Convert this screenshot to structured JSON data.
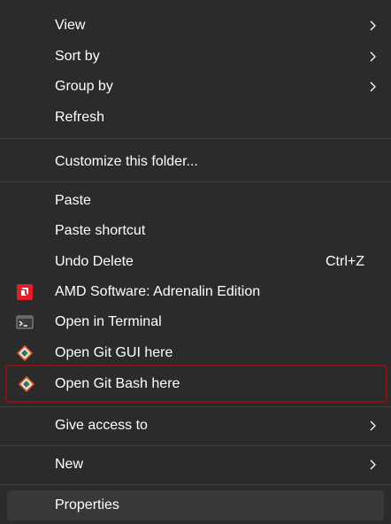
{
  "menu": {
    "items": [
      {
        "label": "View"
      },
      {
        "label": "Sort by"
      },
      {
        "label": "Group by"
      },
      {
        "label": "Refresh"
      },
      {
        "label": "Customize this folder..."
      },
      {
        "label": "Paste"
      },
      {
        "label": "Paste shortcut"
      },
      {
        "label": "Undo Delete",
        "shortcut": "Ctrl+Z"
      },
      {
        "label": "AMD Software: Adrenalin Edition",
        "icon": "amd-icon"
      },
      {
        "label": "Open in Terminal",
        "icon": "terminal-icon"
      },
      {
        "label": "Open Git GUI here",
        "icon": "git-icon"
      },
      {
        "label": "Open Git Bash here",
        "icon": "git-icon"
      },
      {
        "label": "Give access to"
      },
      {
        "label": "New"
      },
      {
        "label": "Properties"
      }
    ]
  },
  "colors": {
    "background": "#2b2b2b",
    "separator": "#3d3d3d",
    "highlight_border": "#8a1212",
    "hover_background": "#383838",
    "amd_red": "#e01d2a",
    "git_orange": "#e8622a"
  }
}
